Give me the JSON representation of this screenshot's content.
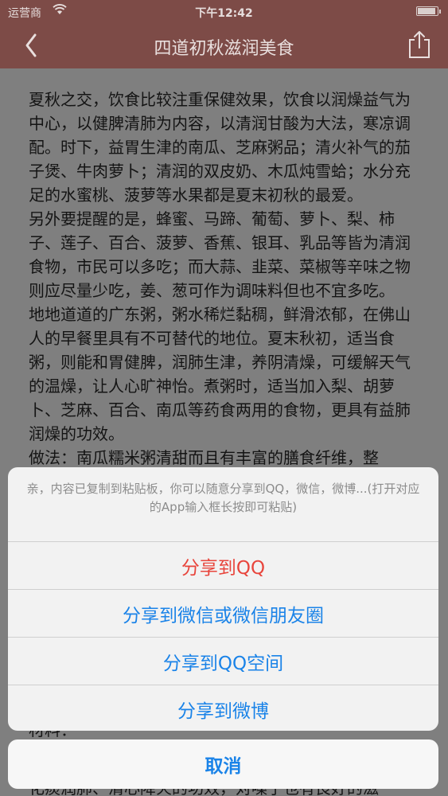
{
  "status_bar": {
    "carrier": "运营商",
    "time": "下午12:42"
  },
  "nav": {
    "title": "四道初秋滋润美食"
  },
  "article": {
    "paragraphs": [
      "夏秋之交，饮食比较注重保健效果，饮食以润燥益气为中心，以健脾清肺为内容，以清润甘酸为大法，寒凉调配。时下，益胃生津的南瓜、芝麻粥品；清火补气的茄子煲、牛肉萝卜；清润的双皮奶、木瓜炖雪蛤；水分充足的水蜜桃、菠萝等水果都是夏末初秋的最爱。",
      "另外要提醒的是，蜂蜜、马蹄、葡萄、萝卜、梨、柿子、莲子、百合、菠萝、香蕉、银耳、乳品等皆为清润食物，市民可以多吃；而大蒜、韭菜、菜椒等辛味之物则应尽量少吃，姜、葱可作为调味料但也不宜多吃。",
      "地地道道的广东粥，粥水稀烂黏稠，鲜滑浓郁，在佛山人的早餐里具有不可替代的地位。夏末秋初，适当食粥，则能和胃健脾，润肺生津，养阴清燥，可缓解天气的温燥，让人心旷神怡。煮粥时，适当加入梨、胡萝卜、芝麻、百合、南瓜等药食两用的食物，更具有益肺润燥的功效。",
      "做法：南瓜糯米粥清甜而且有丰富的膳食纤维，整"
    ],
    "tail_line_1": "材料：",
    "tail_line_2": "化痰润肺、清心降火的功效，对嗓子也有良好的滋"
  },
  "action_sheet": {
    "message": "亲，内容已复制到粘贴板，你可以随意分享到QQ，微信，微博...(打开对应的App输入框长按即可粘贴)",
    "options": [
      "分享到QQ",
      "分享到微信或微信朋友圈",
      "分享到QQ空间",
      "分享到微博"
    ],
    "cancel": "取消"
  }
}
